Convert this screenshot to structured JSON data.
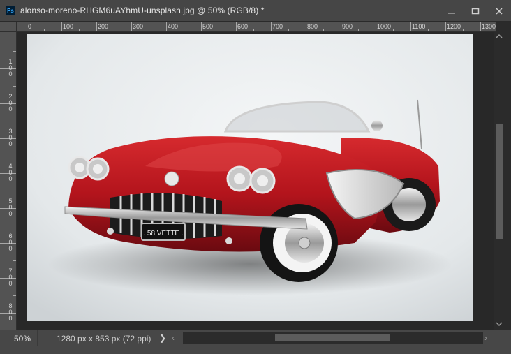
{
  "window": {
    "app_icon": "Ps",
    "title": "alonso-moreno-RHGM6uAYhmU-unsplash.jpg @ 50% (RGB/8) *",
    "buttons": {
      "minimize": "─",
      "maximize": "☐",
      "close": "✕"
    }
  },
  "rulers": {
    "horizontal": [
      "0",
      "100",
      "200",
      "300",
      "400",
      "500",
      "600",
      "700",
      "800",
      "900",
      "1000",
      "1100",
      "1200",
      "1300"
    ],
    "vertical": [
      "1\n0\n0",
      "2\n0\n0",
      "3\n0\n0",
      "4\n0\n0",
      "5\n0\n0",
      "6\n0\n0",
      "7\n0\n0",
      "8\n0\n0"
    ]
  },
  "canvas": {
    "plate_text": ". 58 VETTE .",
    "car_color": "#b3141c"
  },
  "status": {
    "zoom": "50%",
    "doc_info": "1280 px x 853 px (72 ppi)",
    "arrow": "❯",
    "scroll_left": "‹",
    "scroll_right": "›"
  }
}
